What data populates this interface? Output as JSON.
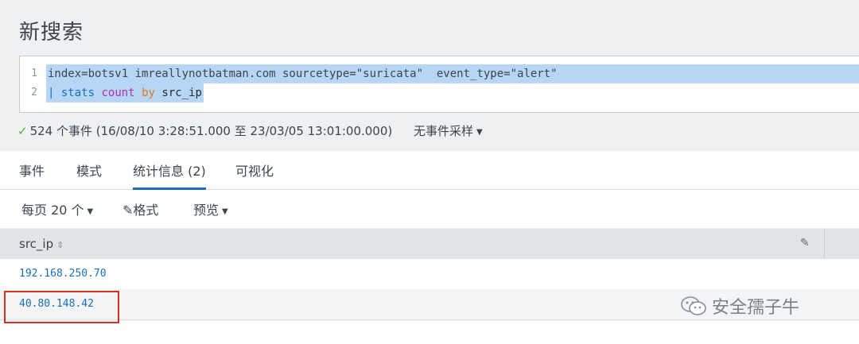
{
  "page": {
    "title": "新搜索"
  },
  "editor": {
    "lines": [
      {
        "number": "1",
        "text": "index=botsv1 imreallynotbatman.com sourcetype=\"suricata\"  event_type=\"alert\""
      },
      {
        "number": "2",
        "pipe": "|",
        "cmd": "stats",
        "fn": "count",
        "by": "by",
        "field": "src_ip"
      }
    ]
  },
  "status": {
    "check": "✓",
    "summary": "524 个事件 (16/08/10 3:28:51.000 至 23/03/05 13:01:00.000)",
    "sampling": "无事件采样"
  },
  "tabs": [
    {
      "label": "事件"
    },
    {
      "label": "模式"
    },
    {
      "label": "统计信息 (2)",
      "active": true
    },
    {
      "label": "可视化"
    }
  ],
  "toolbar": {
    "per_page": "每页 20 个",
    "format": "格式",
    "preview": "预览"
  },
  "table": {
    "column": "src_ip",
    "rows": [
      "192.168.250.70",
      "40.80.148.42"
    ]
  },
  "watermark": {
    "text": "安全孺子牛"
  },
  "colors": {
    "accent": "#1a6fb7",
    "highlight_border": "#d93025",
    "selection": "#b7d6f5"
  }
}
